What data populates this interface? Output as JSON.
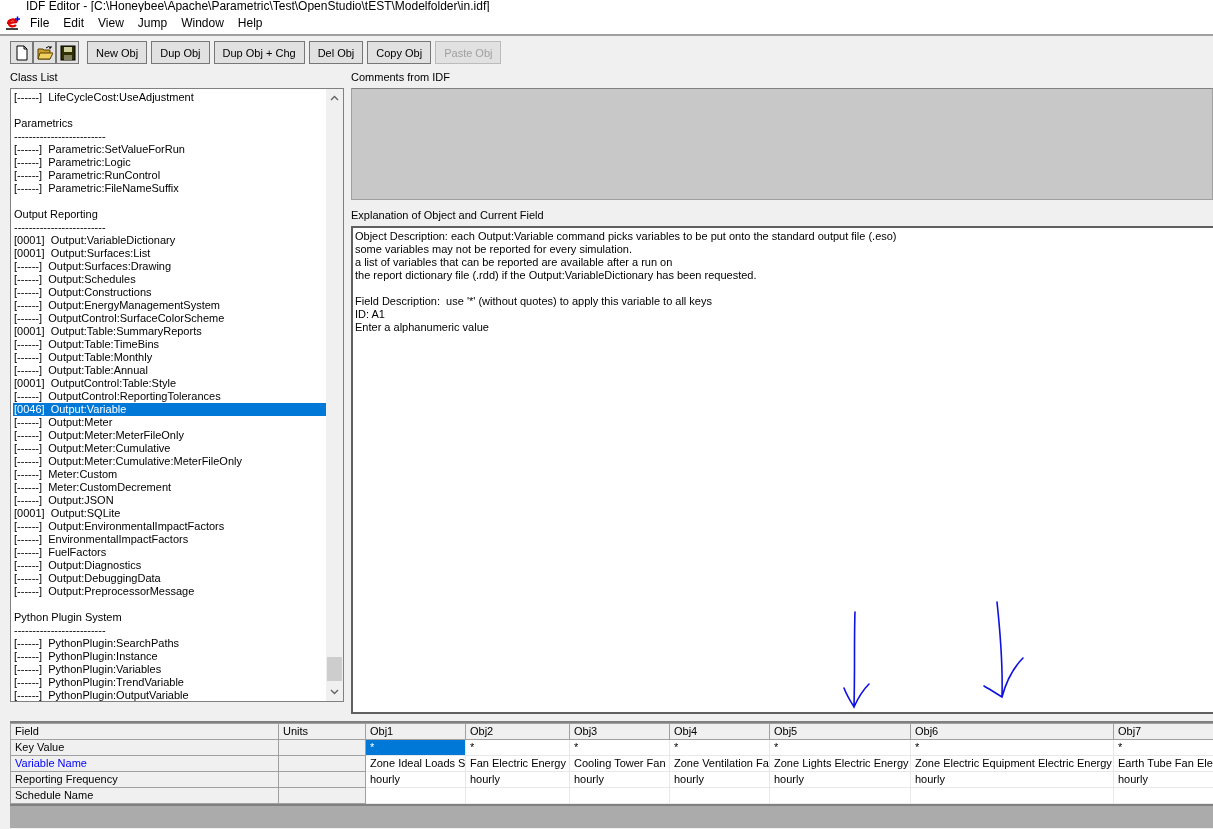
{
  "window": {
    "title": "IDF Editor - [C:\\Honeybee\\Apache\\Parametric\\Test\\OpenStudio\\tEST\\Modelfolder\\in.idf]"
  },
  "menu": [
    "File",
    "Edit",
    "View",
    "Jump",
    "Window",
    "Help"
  ],
  "toolbar": [
    {
      "kind": "new"
    },
    {
      "kind": "open"
    },
    {
      "kind": "save"
    },
    {
      "kind": "text",
      "label": "New Obj",
      "disabled": false
    },
    {
      "kind": "text",
      "label": "Dup Obj",
      "disabled": false
    },
    {
      "kind": "text",
      "label": "Dup Obj + Chg",
      "disabled": false
    },
    {
      "kind": "text",
      "label": "Del Obj",
      "disabled": false
    },
    {
      "kind": "text",
      "label": "Copy Obj",
      "disabled": false
    },
    {
      "kind": "text",
      "label": "Paste Obj",
      "disabled": true
    }
  ],
  "class_list": {
    "label": "Class List",
    "items": [
      {
        "kind": "class",
        "text": "[------]  LifeCycleCost:UseAdjustment",
        "selected": false
      },
      {
        "kind": "blank"
      },
      {
        "kind": "heading",
        "text": "Parametrics"
      },
      {
        "kind": "heading",
        "text": "-------------------------"
      },
      {
        "kind": "class",
        "text": "[------]  Parametric:SetValueForRun",
        "selected": false
      },
      {
        "kind": "class",
        "text": "[------]  Parametric:Logic",
        "selected": false
      },
      {
        "kind": "class",
        "text": "[------]  Parametric:RunControl",
        "selected": false
      },
      {
        "kind": "class",
        "text": "[------]  Parametric:FileNameSuffix",
        "selected": false
      },
      {
        "kind": "blank"
      },
      {
        "kind": "heading",
        "text": "Output Reporting"
      },
      {
        "kind": "heading",
        "text": "-------------------------"
      },
      {
        "kind": "class",
        "text": "[0001]  Output:VariableDictionary",
        "selected": false
      },
      {
        "kind": "class",
        "text": "[0001]  Output:Surfaces:List",
        "selected": false
      },
      {
        "kind": "class",
        "text": "[------]  Output:Surfaces:Drawing",
        "selected": false
      },
      {
        "kind": "class",
        "text": "[------]  Output:Schedules",
        "selected": false
      },
      {
        "kind": "class",
        "text": "[------]  Output:Constructions",
        "selected": false
      },
      {
        "kind": "class",
        "text": "[------]  Output:EnergyManagementSystem",
        "selected": false
      },
      {
        "kind": "class",
        "text": "[------]  OutputControl:SurfaceColorScheme",
        "selected": false
      },
      {
        "kind": "class",
        "text": "[0001]  Output:Table:SummaryReports",
        "selected": false
      },
      {
        "kind": "class",
        "text": "[------]  Output:Table:TimeBins",
        "selected": false
      },
      {
        "kind": "class",
        "text": "[------]  Output:Table:Monthly",
        "selected": false
      },
      {
        "kind": "class",
        "text": "[------]  Output:Table:Annual",
        "selected": false
      },
      {
        "kind": "class",
        "text": "[0001]  OutputControl:Table:Style",
        "selected": false
      },
      {
        "kind": "class",
        "text": "[------]  OutputControl:ReportingTolerances",
        "selected": false
      },
      {
        "kind": "class",
        "text": "[0046]  Output:Variable",
        "selected": true
      },
      {
        "kind": "class",
        "text": "[------]  Output:Meter",
        "selected": false
      },
      {
        "kind": "class",
        "text": "[------]  Output:Meter:MeterFileOnly",
        "selected": false
      },
      {
        "kind": "class",
        "text": "[------]  Output:Meter:Cumulative",
        "selected": false
      },
      {
        "kind": "class",
        "text": "[------]  Output:Meter:Cumulative:MeterFileOnly",
        "selected": false
      },
      {
        "kind": "class",
        "text": "[------]  Meter:Custom",
        "selected": false
      },
      {
        "kind": "class",
        "text": "[------]  Meter:CustomDecrement",
        "selected": false
      },
      {
        "kind": "class",
        "text": "[------]  Output:JSON",
        "selected": false
      },
      {
        "kind": "class",
        "text": "[0001]  Output:SQLite",
        "selected": false
      },
      {
        "kind": "class",
        "text": "[------]  Output:EnvironmentalImpactFactors",
        "selected": false
      },
      {
        "kind": "class",
        "text": "[------]  EnvironmentalImpactFactors",
        "selected": false
      },
      {
        "kind": "class",
        "text": "[------]  FuelFactors",
        "selected": false
      },
      {
        "kind": "class",
        "text": "[------]  Output:Diagnostics",
        "selected": false
      },
      {
        "kind": "class",
        "text": "[------]  Output:DebuggingData",
        "selected": false
      },
      {
        "kind": "class",
        "text": "[------]  Output:PreprocessorMessage",
        "selected": false
      },
      {
        "kind": "blank"
      },
      {
        "kind": "heading",
        "text": "Python Plugin System"
      },
      {
        "kind": "heading",
        "text": "-------------------------"
      },
      {
        "kind": "class",
        "text": "[------]  PythonPlugin:SearchPaths",
        "selected": false
      },
      {
        "kind": "class",
        "text": "[------]  PythonPlugin:Instance",
        "selected": false
      },
      {
        "kind": "class",
        "text": "[------]  PythonPlugin:Variables",
        "selected": false
      },
      {
        "kind": "class",
        "text": "[------]  PythonPlugin:TrendVariable",
        "selected": false
      },
      {
        "kind": "class",
        "text": "[------]  PythonPlugin:OutputVariable",
        "selected": false
      }
    ]
  },
  "comments": {
    "label": "Comments from IDF"
  },
  "explanation": {
    "label": "Explanation of Object and Current Field",
    "paragraphs": [
      [
        "Object Description: each Output:Variable command picks variables to be put onto the standard output file (.eso)",
        "some variables may not be reported for every simulation.",
        "a list of variables that can be reported are available after a run on",
        "the report dictionary file (.rdd) if the Output:VariableDictionary has been requested."
      ],
      [
        "Field Description:  use '*' (without quotes) to apply this variable to all keys",
        "ID: A1",
        "Enter a alphanumeric value"
      ]
    ]
  },
  "grid": {
    "field_header": "Field",
    "units_header": "Units",
    "columns": [
      "Obj1",
      "Obj2",
      "Obj3",
      "Obj4",
      "Obj5",
      "Obj6",
      "Obj7"
    ],
    "rows": [
      {
        "field": "Key Value",
        "current": false,
        "cells": [
          {
            "text": "*",
            "selected": true
          },
          {
            "text": "*",
            "selected": false
          },
          {
            "text": "*",
            "selected": false
          },
          {
            "text": "*",
            "selected": false
          },
          {
            "text": "*",
            "selected": false
          },
          {
            "text": "*",
            "selected": false
          },
          {
            "text": "*",
            "selected": false
          }
        ]
      },
      {
        "field": "Variable Name",
        "current": true,
        "cells": [
          {
            "text": "Zone Ideal Loads S",
            "selected": false
          },
          {
            "text": "Fan Electric Energy",
            "selected": false
          },
          {
            "text": "Cooling Tower Fan",
            "selected": false
          },
          {
            "text": "Zone Ventilation Fa",
            "selected": false
          },
          {
            "text": "Zone Lights Electric Energy",
            "selected": false
          },
          {
            "text": "Zone Electric Equipment Electric Energy",
            "selected": false
          },
          {
            "text": "Earth Tube Fan Ele",
            "selected": false
          }
        ]
      },
      {
        "field": "Reporting Frequency",
        "current": false,
        "cells": [
          {
            "text": "hourly",
            "selected": false
          },
          {
            "text": "hourly",
            "selected": false
          },
          {
            "text": "hourly",
            "selected": false
          },
          {
            "text": "hourly",
            "selected": false
          },
          {
            "text": "hourly",
            "selected": false
          },
          {
            "text": "hourly",
            "selected": false
          },
          {
            "text": "hourly",
            "selected": false
          }
        ]
      },
      {
        "field": "Schedule Name",
        "current": false,
        "cells": []
      }
    ]
  },
  "annotations": [
    {
      "kind": "arrow"
    },
    {
      "kind": "arrow"
    }
  ]
}
